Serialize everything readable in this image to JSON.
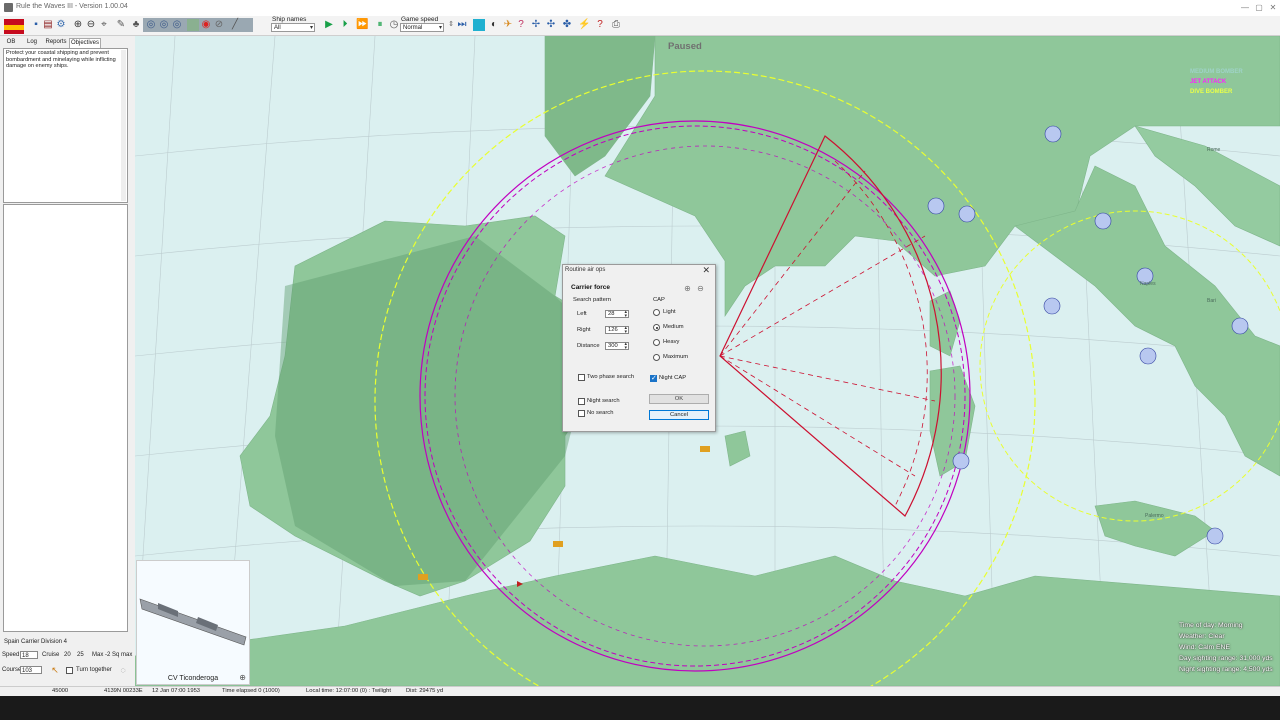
{
  "window": {
    "title": "Rule the Waves III - Version 1.00.04",
    "colors": {
      "accent": "#0078d7",
      "land": "#8fc79a",
      "sea": "#dbf0f0"
    }
  },
  "toolbar": {
    "ship_names_label": "Ship names",
    "ship_names_value": "All",
    "game_speed_label": "Game speed",
    "game_speed_value": "Normal"
  },
  "left_panel": {
    "tabs": [
      "OB",
      "Log",
      "Reports",
      "Objectives"
    ],
    "active_tab": "Objectives",
    "objective_text": "Protect your coastal shipping and prevent bombardment and minelaying while inflicting damage on enemy ships.",
    "division_name": "Spain Carrier Division 4",
    "speed_label": "Speed",
    "speed_value": "18",
    "cruise_label": "Cruise",
    "cruise_value": "20",
    "max_value": "25",
    "max_label": "Max -2",
    "sq_max_label": "Sq max",
    "course_label": "Course",
    "course_value": "103",
    "turn_together_label": "Turn together",
    "ship_name": "CV Ticonderoga"
  },
  "status_bar": {
    "s1": "45000",
    "s2": "4139N 00233E",
    "s3": "12 Jan 07:00 1953",
    "s4": "Time elapsed 0 (1000)",
    "s5": "Local time: 12:07:00 (0) : Twilight",
    "s6": "Dist: 29475 yd"
  },
  "map": {
    "paused_label": "Paused",
    "legend": [
      {
        "label": "MEDIUM BOMBER",
        "color": "#9fd3c7"
      },
      {
        "label": "JET ATTACK",
        "color": "#ff20ff"
      },
      {
        "label": "DIVE BOMBER",
        "color": "#e8ff4a"
      }
    ],
    "weather": {
      "time_of_day": "Time of day: Morning",
      "weather": "Weather: Clear",
      "wind": "Wind: Calm  ENE",
      "day_range": "Day sighting range: 31,000 yds",
      "night_range": "Night sighting range: 4,500 yds"
    },
    "place_labels": [
      "Rome",
      "Naples",
      "Bari",
      "Palermo"
    ]
  },
  "dialog": {
    "title": "Routine air ops",
    "heading": "Carrier force",
    "search_pattern_label": "Search pattern",
    "left_label": "Left",
    "left_value": "28",
    "right_label": "Right",
    "right_value": "126",
    "distance_label": "Distance",
    "distance_value": "300",
    "cap_label": "CAP",
    "cap_options": [
      "Light",
      "Medium",
      "Heavy",
      "Maximum"
    ],
    "cap_selected": "Medium",
    "two_phase_label": "Two phase search",
    "night_cap_label": "Night CAP",
    "night_search_label": "Night search",
    "no_search_label": "No search",
    "ok_label": "OK",
    "cancel_label": "Cancel"
  }
}
